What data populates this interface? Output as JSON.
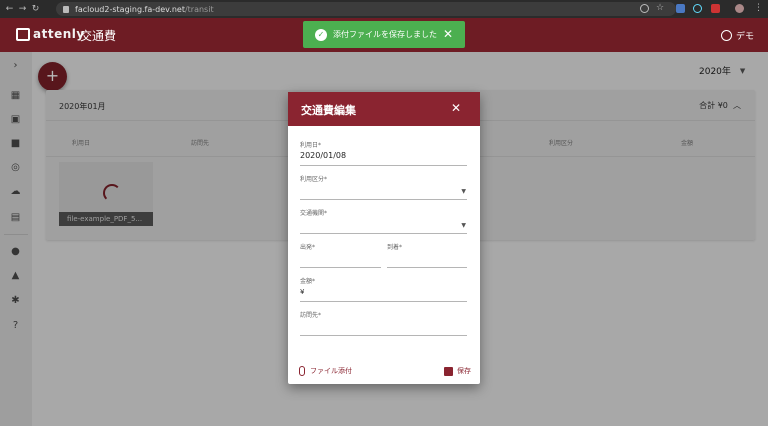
{
  "browser": {
    "url_host": "facloud2-staging.fa-dev.net",
    "url_path": "/transit"
  },
  "app": {
    "logo_text": "attenly",
    "page_title": "交通費",
    "user_name": "デモ"
  },
  "toast": {
    "message": "添付ファイルを保存しました",
    "color": "#4caf50"
  },
  "toolbar": {
    "add_label": "+",
    "year": "2020年"
  },
  "list": {
    "month": "2020年01月",
    "total": "合計 ¥0",
    "columns": [
      "利用日",
      "訪問先",
      "利用区分",
      "金額"
    ],
    "file_name": "file-example_PDF_5..."
  },
  "dialog": {
    "title": "交通費編集",
    "fields": {
      "date_label": "利用日*",
      "date_value": "2020/01/08",
      "category_label": "利用区分*",
      "transport_label": "交通機関*",
      "depart_label": "出発*",
      "arrive_label": "到着*",
      "amount_label": "金額*",
      "amount_prefix": "¥",
      "destination_label": "訪問先*"
    },
    "attach_label": "ファイル添付",
    "save_label": "保存",
    "accent": "#8a2430"
  }
}
